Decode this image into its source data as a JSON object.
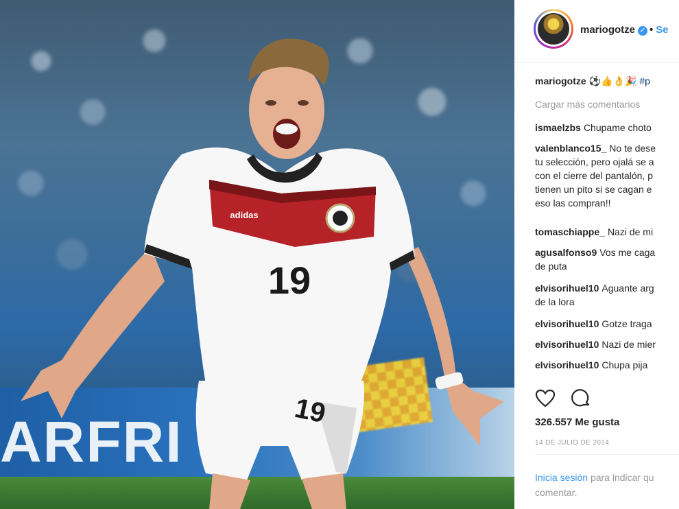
{
  "post": {
    "username": "mariogotze",
    "follow_label": "Se",
    "caption_emojis": "⚽👍👌🎉",
    "caption_hashtag": "#p"
  },
  "photo": {
    "banner_text": "ARFRI",
    "jersey_number": "19",
    "shorts_number": "19",
    "brand_text": "adidas"
  },
  "comments": {
    "load_more": "Cargar más comentarios",
    "items": [
      {
        "user": "ismaelzbs",
        "lines": [
          "Chupame choto"
        ]
      },
      {
        "user": "valenblanco15_",
        "lines": [
          "No te dese",
          "tu selección, pero ojalá se a",
          "con el cierre del pantalón, p",
          "tienen un pito si se cagan e",
          "eso las compran!!"
        ]
      },
      {
        "user": "tomaschiappe_",
        "lines": [
          "Nazi de mi"
        ]
      },
      {
        "user": "agusalfonso9",
        "lines": [
          "Vos me caga",
          "de puta"
        ]
      },
      {
        "user": "elvisorihuel10",
        "lines": [
          "Aguante arg",
          "de la lora"
        ]
      },
      {
        "user": "elvisorihuel10",
        "lines": [
          "Gotze traga"
        ]
      },
      {
        "user": "elvisorihuel10",
        "lines": [
          "Nazi de mier"
        ]
      },
      {
        "user": "elvisorihuel10",
        "lines": [
          "Chupa pija"
        ]
      }
    ]
  },
  "stats": {
    "likes": "326.557 Me gusta",
    "date": "14 DE JULIO DE 2014"
  },
  "login": {
    "link": "Inicia sesión",
    "rest": "para indicar qu",
    "line2": "comentar."
  },
  "icons": [
    "heart-icon",
    "comment-icon",
    "verified-badge-icon"
  ],
  "colors": {
    "link": "#3897f0",
    "muted": "#999999",
    "text": "#262626"
  }
}
